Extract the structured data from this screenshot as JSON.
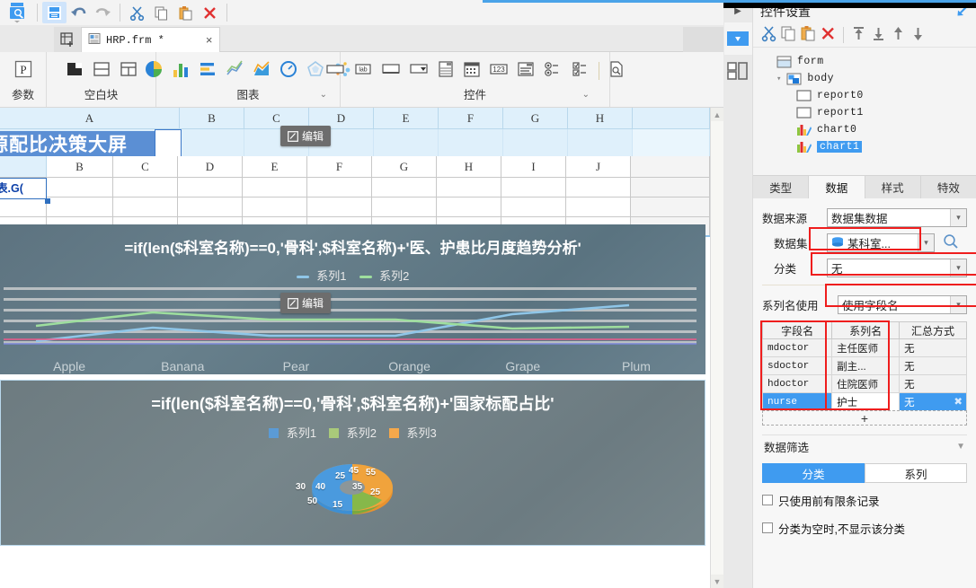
{
  "quick_access": {
    "buttons": [
      {
        "name": "save-button",
        "icon": "save-icon",
        "active": true
      },
      {
        "name": "undo-button",
        "icon": "undo-arrow-icon",
        "active": false
      },
      {
        "name": "redo-button",
        "icon": "redo-arrow-icon",
        "active": false
      },
      {
        "name": "cut-button",
        "icon": "scissors-icon",
        "active": false
      },
      {
        "name": "copy-button",
        "icon": "copy-icon",
        "active": false
      },
      {
        "name": "paste-button",
        "icon": "paste-icon",
        "active": false
      },
      {
        "name": "delete-button",
        "icon": "red-x-icon",
        "active": false
      }
    ]
  },
  "tab": {
    "label": "HRP.frm *",
    "close": "×"
  },
  "ribbon": {
    "groups": [
      {
        "label": "参数",
        "icons": [
          "parameter-p-icon"
        ]
      },
      {
        "label": "空白块",
        "icons": [
          "block-dark-icon",
          "block-split-icon",
          "block-grid-icon"
        ]
      },
      {
        "label": "图表",
        "icons": [
          "pie-chart-icon",
          "bar-chart-icon",
          "hbar-chart-icon",
          "line-chart-icon",
          "area-chart-icon",
          "gauge-chart-icon",
          "radar-chart-icon",
          "bubble-chart-icon"
        ],
        "expand": "⌄"
      },
      {
        "label": "控件",
        "icons": [
          "textbox-icon",
          "label-icon",
          "textarea-icon",
          "combobox-icon",
          "listbox-icon",
          "datepicker-icon",
          "number-icon",
          "richtext-icon",
          "radio-group-icon",
          "checkbox-group-icon",
          "preview-icon"
        ],
        "expand": "⌄"
      }
    ]
  },
  "sheet_top": {
    "columns": [
      "A",
      "B",
      "C",
      "D",
      "E",
      "F",
      "G",
      "H"
    ],
    "title_cell": "源配比决策大屏",
    "edit_badge": "编辑"
  },
  "sheet_bottom": {
    "columns": [
      "",
      "B",
      "C",
      "D",
      "E",
      "F",
      "G",
      "H",
      "I",
      "J"
    ],
    "formula_cell": "表.G("
  },
  "chart_data": [
    {
      "type": "line",
      "title": "=if(len($科室名称)==0,'骨科',$科室名称)+'医、护患比月度趋势分析'",
      "legend": [
        "系列1",
        "系列2"
      ],
      "legend_colors": [
        "#8fc6e8",
        "#9ede9e"
      ],
      "categories": [
        "Apple",
        "Banana",
        "Pear",
        "Orange",
        "Grape",
        "Plum"
      ],
      "series": [
        {
          "name": "系列1",
          "values": [
            8,
            32,
            19,
            19,
            46,
            58
          ]
        },
        {
          "name": "系列2",
          "values": [
            38,
            58,
            48,
            48,
            30,
            32
          ]
        }
      ],
      "edit_badge": "编辑",
      "grid": true,
      "legend_position": "top"
    },
    {
      "type": "pie",
      "title": "=if(len($科室名称)==0,'骨科',$科室名称)+'国家标配占比'",
      "legend": [
        "系列1",
        "系列2",
        "系列3"
      ],
      "legend_colors": [
        "#5b9bd5",
        "#a9c97a",
        "#f5a84b"
      ],
      "labels": [
        "30",
        "40",
        "50",
        "25",
        "45",
        "55",
        "35",
        "15",
        "25"
      ],
      "values": [
        30,
        40,
        50,
        25,
        45,
        55,
        35,
        15,
        25
      ],
      "legend_position": "top"
    }
  ],
  "right_panel": {
    "title": "控件设置",
    "expand_icon": "expand-arrow-icon",
    "collapse_icon": "collapse-triangle-icon",
    "rail": [
      {
        "name": "rail-properties",
        "icon": "blue-dropdown-icon",
        "selected": true
      },
      {
        "name": "rail-layout",
        "icon": "layout-blocks-icon",
        "selected": false
      }
    ],
    "toolbar": [
      {
        "name": "cut-button",
        "icon": "scissors-icon"
      },
      {
        "name": "copy-button",
        "icon": "copy-icon"
      },
      {
        "name": "paste-button",
        "icon": "paste-icon"
      },
      {
        "name": "delete-button",
        "icon": "red-x-icon"
      },
      {
        "name": "move-top-button",
        "icon": "move-to-top-icon"
      },
      {
        "name": "move-bottom-button",
        "icon": "move-to-bottom-icon"
      },
      {
        "name": "move-up-button",
        "icon": "move-up-icon"
      },
      {
        "name": "move-down-button",
        "icon": "move-down-icon"
      }
    ],
    "tree": [
      {
        "label": "form",
        "icon": "form-icon",
        "depth": 0,
        "selected": false
      },
      {
        "label": "body",
        "icon": "body-icon",
        "depth": 1,
        "selected": false,
        "expander": "▾"
      },
      {
        "label": "report0",
        "icon": "report-icon",
        "depth": 2,
        "selected": false
      },
      {
        "label": "report1",
        "icon": "report-icon",
        "depth": 2,
        "selected": false
      },
      {
        "label": "chart0",
        "icon": "chart-icon",
        "depth": 2,
        "selected": false
      },
      {
        "label": "chart1",
        "icon": "chart-icon",
        "depth": 2,
        "selected": true
      }
    ],
    "tabs": [
      {
        "label": "类型",
        "active": false
      },
      {
        "label": "数据",
        "active": true
      },
      {
        "label": "样式",
        "active": false
      },
      {
        "label": "特效",
        "active": false
      }
    ],
    "fields": {
      "datasource_label": "数据来源",
      "datasource_value": "数据集数据",
      "dataset_label": "数据集",
      "dataset_value": "某科室...",
      "dataset_icon": "database-icon",
      "search_icon": "magnifier-icon",
      "category_label": "分类",
      "category_value": "无",
      "seriesname_label": "系列名使用",
      "seriesname_value": "使用字段名"
    },
    "table": {
      "headers": [
        "字段名",
        "系列名",
        "汇总方式"
      ],
      "rows": [
        {
          "field": "mdoctor",
          "series": "主任医师",
          "agg": "无",
          "selected": false
        },
        {
          "field": "sdoctor",
          "series": "副主...",
          "agg": "无",
          "selected": false
        },
        {
          "field": "hdoctor",
          "series": "住院医师",
          "agg": "无",
          "selected": false
        },
        {
          "field": "nurse",
          "series": "护士",
          "agg": "无",
          "selected": true
        }
      ],
      "add_label": "+",
      "remove_icon": "remove-x-icon"
    },
    "filter": {
      "section_label": "数据筛选",
      "segments": [
        {
          "label": "分类",
          "active": true
        },
        {
          "label": "系列",
          "active": false
        }
      ],
      "checkboxes": [
        {
          "label": "只使用前有限条记录",
          "checked": false
        },
        {
          "label": "分类为空时,不显示该分类",
          "checked": false
        }
      ]
    }
  },
  "colors": {
    "accent_blue": "#3f9bf0",
    "highlight_red": "#ef1d1d",
    "title_blue": "#5b8fd4"
  }
}
